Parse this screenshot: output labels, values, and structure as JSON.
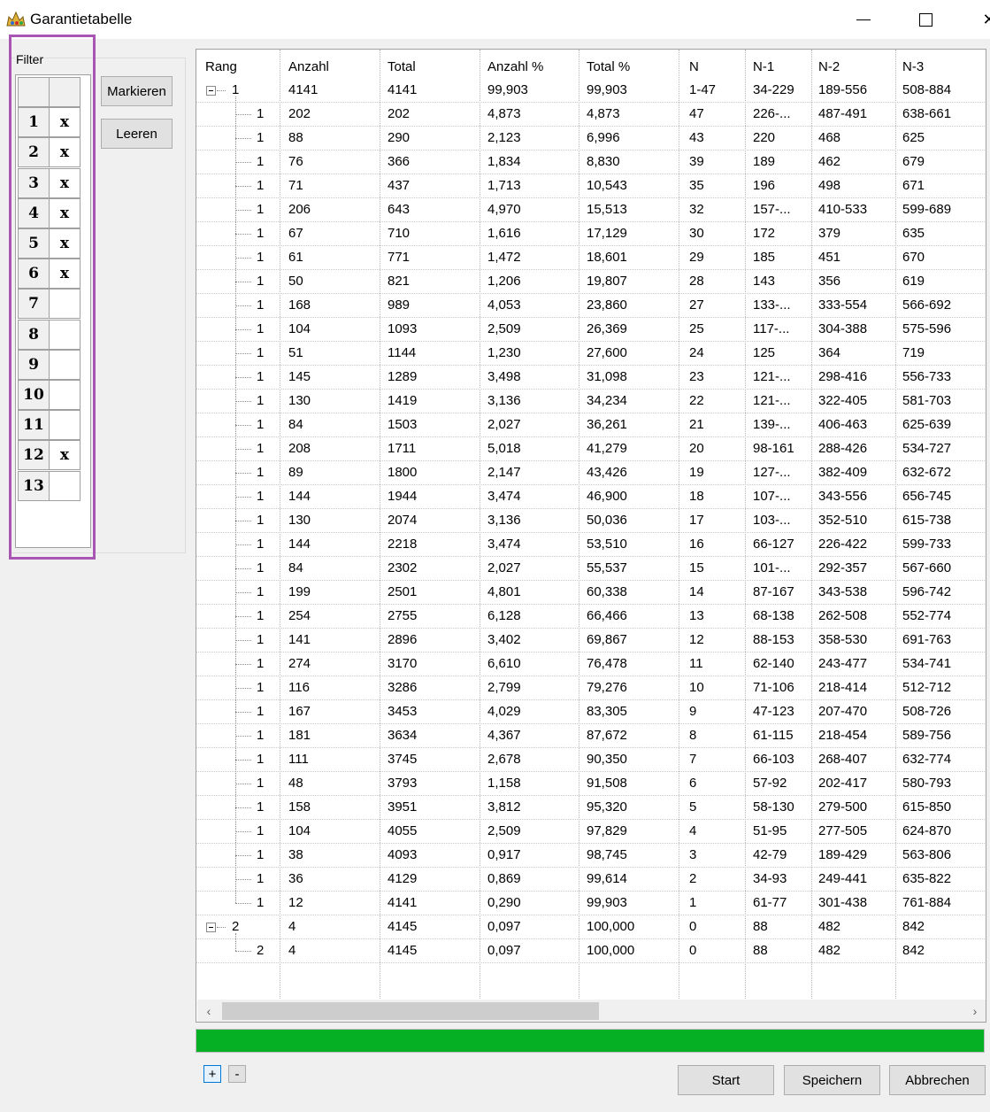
{
  "window": {
    "title": "Garantietabelle",
    "minimize_icon": "minimize-icon",
    "maximize_icon": "maximize-icon",
    "close_icon": "close-icon",
    "close_glyph": "✕"
  },
  "filter": {
    "legend": "Filter",
    "rows": [
      {
        "num": "1",
        "mark": "x"
      },
      {
        "num": "2",
        "mark": "x"
      },
      {
        "num": "3",
        "mark": "x"
      },
      {
        "num": "4",
        "mark": "x"
      },
      {
        "num": "5",
        "mark": "x"
      },
      {
        "num": "6",
        "mark": "x"
      },
      {
        "num": "7",
        "mark": ""
      },
      {
        "num": "8",
        "mark": ""
      },
      {
        "num": "9",
        "mark": ""
      },
      {
        "num": "10",
        "mark": ""
      },
      {
        "num": "11",
        "mark": ""
      },
      {
        "num": "12",
        "mark": "x"
      },
      {
        "num": "13",
        "mark": ""
      }
    ],
    "markieren_label": "Markieren",
    "leeren_label": "Leeren",
    "highlight_color": "#a855b4"
  },
  "table": {
    "columns": [
      "Rang",
      "Anzahl",
      "Total",
      "Anzahl %",
      "Total %",
      "N",
      "N-1",
      "N-2",
      "N-3"
    ],
    "rows": [
      {
        "level": 0,
        "cells": [
          "1",
          "4141",
          "4141",
          "99,903",
          "99,903",
          "1-47",
          "34-229",
          "189-556",
          "508-884"
        ]
      },
      {
        "level": 1,
        "cells": [
          "1",
          "202",
          "202",
          "4,873",
          "4,873",
          "47",
          "226-...",
          "487-491",
          "638-661"
        ]
      },
      {
        "level": 1,
        "cells": [
          "1",
          "88",
          "290",
          "2,123",
          "6,996",
          "43",
          "220",
          "468",
          "625"
        ]
      },
      {
        "level": 1,
        "cells": [
          "1",
          "76",
          "366",
          "1,834",
          "8,830",
          "39",
          "189",
          "462",
          "679"
        ]
      },
      {
        "level": 1,
        "cells": [
          "1",
          "71",
          "437",
          "1,713",
          "10,543",
          "35",
          "196",
          "498",
          "671"
        ]
      },
      {
        "level": 1,
        "cells": [
          "1",
          "206",
          "643",
          "4,970",
          "15,513",
          "32",
          "157-...",
          "410-533",
          "599-689"
        ]
      },
      {
        "level": 1,
        "cells": [
          "1",
          "67",
          "710",
          "1,616",
          "17,129",
          "30",
          "172",
          "379",
          "635"
        ]
      },
      {
        "level": 1,
        "cells": [
          "1",
          "61",
          "771",
          "1,472",
          "18,601",
          "29",
          "185",
          "451",
          "670"
        ]
      },
      {
        "level": 1,
        "cells": [
          "1",
          "50",
          "821",
          "1,206",
          "19,807",
          "28",
          "143",
          "356",
          "619"
        ]
      },
      {
        "level": 1,
        "cells": [
          "1",
          "168",
          "989",
          "4,053",
          "23,860",
          "27",
          "133-...",
          "333-554",
          "566-692"
        ]
      },
      {
        "level": 1,
        "cells": [
          "1",
          "104",
          "1093",
          "2,509",
          "26,369",
          "25",
          "117-...",
          "304-388",
          "575-596"
        ]
      },
      {
        "level": 1,
        "cells": [
          "1",
          "51",
          "1144",
          "1,230",
          "27,600",
          "24",
          "125",
          "364",
          "719"
        ]
      },
      {
        "level": 1,
        "cells": [
          "1",
          "145",
          "1289",
          "3,498",
          "31,098",
          "23",
          "121-...",
          "298-416",
          "556-733"
        ]
      },
      {
        "level": 1,
        "cells": [
          "1",
          "130",
          "1419",
          "3,136",
          "34,234",
          "22",
          "121-...",
          "322-405",
          "581-703"
        ]
      },
      {
        "level": 1,
        "cells": [
          "1",
          "84",
          "1503",
          "2,027",
          "36,261",
          "21",
          "139-...",
          "406-463",
          "625-639"
        ]
      },
      {
        "level": 1,
        "cells": [
          "1",
          "208",
          "1711",
          "5,018",
          "41,279",
          "20",
          "98-161",
          "288-426",
          "534-727"
        ]
      },
      {
        "level": 1,
        "cells": [
          "1",
          "89",
          "1800",
          "2,147",
          "43,426",
          "19",
          "127-...",
          "382-409",
          "632-672"
        ]
      },
      {
        "level": 1,
        "cells": [
          "1",
          "144",
          "1944",
          "3,474",
          "46,900",
          "18",
          "107-...",
          "343-556",
          "656-745"
        ]
      },
      {
        "level": 1,
        "cells": [
          "1",
          "130",
          "2074",
          "3,136",
          "50,036",
          "17",
          "103-...",
          "352-510",
          "615-738"
        ]
      },
      {
        "level": 1,
        "cells": [
          "1",
          "144",
          "2218",
          "3,474",
          "53,510",
          "16",
          "66-127",
          "226-422",
          "599-733"
        ]
      },
      {
        "level": 1,
        "cells": [
          "1",
          "84",
          "2302",
          "2,027",
          "55,537",
          "15",
          "101-...",
          "292-357",
          "567-660"
        ]
      },
      {
        "level": 1,
        "cells": [
          "1",
          "199",
          "2501",
          "4,801",
          "60,338",
          "14",
          "87-167",
          "343-538",
          "596-742"
        ]
      },
      {
        "level": 1,
        "cells": [
          "1",
          "254",
          "2755",
          "6,128",
          "66,466",
          "13",
          "68-138",
          "262-508",
          "552-774"
        ]
      },
      {
        "level": 1,
        "cells": [
          "1",
          "141",
          "2896",
          "3,402",
          "69,867",
          "12",
          "88-153",
          "358-530",
          "691-763"
        ]
      },
      {
        "level": 1,
        "cells": [
          "1",
          "274",
          "3170",
          "6,610",
          "76,478",
          "11",
          "62-140",
          "243-477",
          "534-741"
        ]
      },
      {
        "level": 1,
        "cells": [
          "1",
          "116",
          "3286",
          "2,799",
          "79,276",
          "10",
          "71-106",
          "218-414",
          "512-712"
        ]
      },
      {
        "level": 1,
        "cells": [
          "1",
          "167",
          "3453",
          "4,029",
          "83,305",
          "9",
          "47-123",
          "207-470",
          "508-726"
        ]
      },
      {
        "level": 1,
        "cells": [
          "1",
          "181",
          "3634",
          "4,367",
          "87,672",
          "8",
          "61-115",
          "218-454",
          "589-756"
        ]
      },
      {
        "level": 1,
        "cells": [
          "1",
          "111",
          "3745",
          "2,678",
          "90,350",
          "7",
          "66-103",
          "268-407",
          "632-774"
        ]
      },
      {
        "level": 1,
        "cells": [
          "1",
          "48",
          "3793",
          "1,158",
          "91,508",
          "6",
          "57-92",
          "202-417",
          "580-793"
        ]
      },
      {
        "level": 1,
        "cells": [
          "1",
          "158",
          "3951",
          "3,812",
          "95,320",
          "5",
          "58-130",
          "279-500",
          "615-850"
        ]
      },
      {
        "level": 1,
        "cells": [
          "1",
          "104",
          "4055",
          "2,509",
          "97,829",
          "4",
          "51-95",
          "277-505",
          "624-870"
        ]
      },
      {
        "level": 1,
        "cells": [
          "1",
          "38",
          "4093",
          "0,917",
          "98,745",
          "3",
          "42-79",
          "189-429",
          "563-806"
        ]
      },
      {
        "level": 1,
        "cells": [
          "1",
          "36",
          "4129",
          "0,869",
          "99,614",
          "2",
          "34-93",
          "249-441",
          "635-822"
        ]
      },
      {
        "level": 1,
        "cells": [
          "1",
          "12",
          "4141",
          "0,290",
          "99,903",
          "1",
          "61-77",
          "301-438",
          "761-884"
        ]
      },
      {
        "level": 0,
        "cells": [
          "2",
          "4",
          "4145",
          "0,097",
          "100,000",
          "0",
          "88",
          "482",
          "842"
        ]
      },
      {
        "level": 1,
        "cells": [
          "2",
          "4",
          "4145",
          "0,097",
          "100,000",
          "0",
          "88",
          "482",
          "842"
        ]
      }
    ]
  },
  "scrollbar": {
    "left_arrow": "‹",
    "right_arrow": "›",
    "thumb_fraction": 0.51
  },
  "progress": {
    "fraction": 1.0,
    "color": "#06b025"
  },
  "footer": {
    "expand_label": "+",
    "collapse_label": "-",
    "start_label": "Start",
    "save_label": "Speichern",
    "cancel_label": "Abbrechen"
  }
}
